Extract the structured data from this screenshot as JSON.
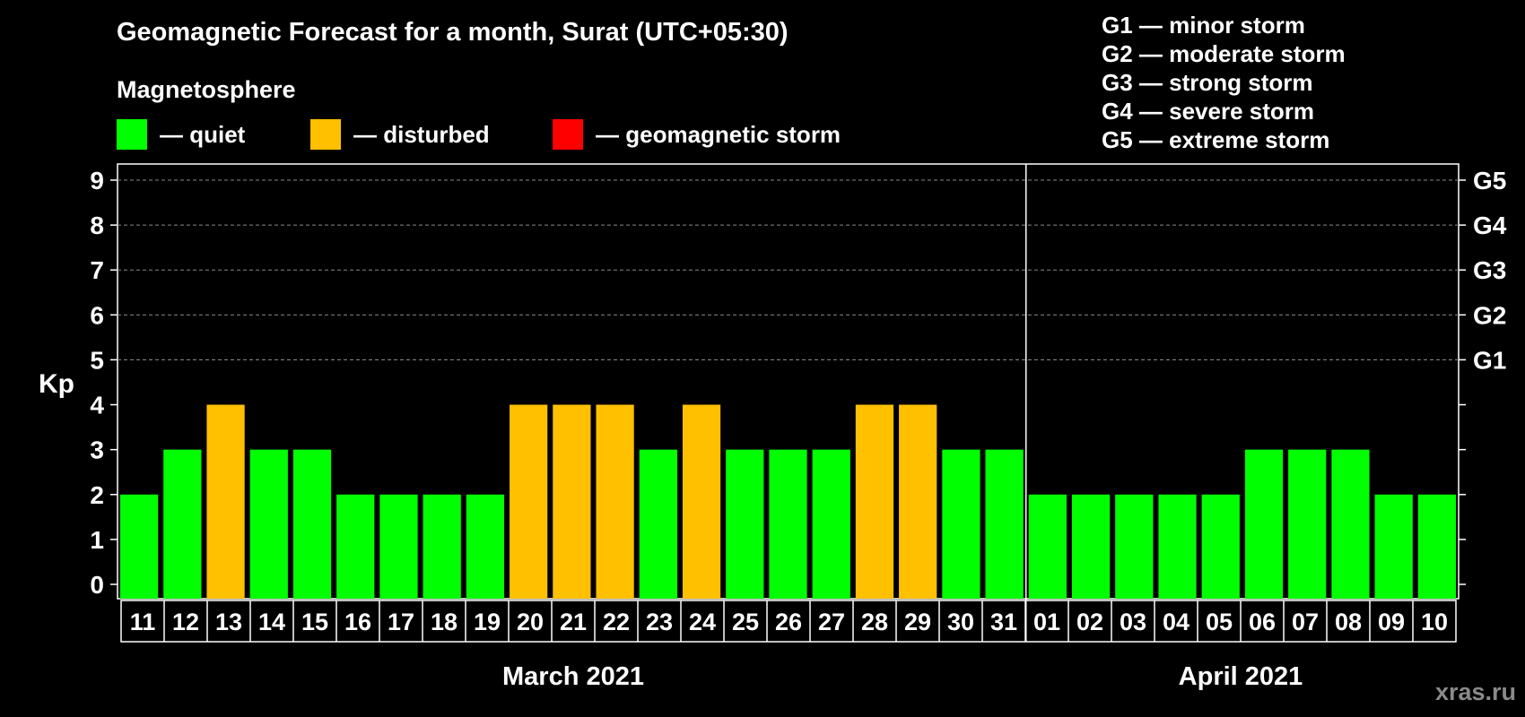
{
  "header": {
    "title": "Geomagnetic Forecast for a month, Surat (UTC+05:30)",
    "subtitle": "Magnetosphere"
  },
  "legend": [
    {
      "label": "— quiet",
      "color": "#00ff00"
    },
    {
      "label": "— disturbed",
      "color": "#ffc000"
    },
    {
      "label": "— geomagnetic storm",
      "color": "#ff0000"
    }
  ],
  "storm_levels": [
    "G1 — minor storm",
    "G2 — moderate storm",
    "G3 — strong storm",
    "G4 — severe storm",
    "G5 — extreme storm"
  ],
  "credit": "xras.ru",
  "chart_data": {
    "type": "bar",
    "ylabel": "Kp",
    "ylim": [
      0,
      9
    ],
    "yticks": [
      0,
      1,
      2,
      3,
      4,
      5,
      6,
      7,
      8,
      9
    ],
    "right_ticks": [
      {
        "value": 5,
        "label": "G1"
      },
      {
        "value": 6,
        "label": "G2"
      },
      {
        "value": 7,
        "label": "G3"
      },
      {
        "value": 8,
        "label": "G4"
      },
      {
        "value": 9,
        "label": "G5"
      }
    ],
    "gridlines": [
      5,
      6,
      7,
      8,
      9
    ],
    "categories": [
      "11",
      "12",
      "13",
      "14",
      "15",
      "16",
      "17",
      "18",
      "19",
      "20",
      "21",
      "22",
      "23",
      "24",
      "25",
      "26",
      "27",
      "28",
      "29",
      "30",
      "31",
      "01",
      "02",
      "03",
      "04",
      "05",
      "06",
      "07",
      "08",
      "09",
      "10"
    ],
    "values": [
      2,
      3,
      4,
      3,
      3,
      2,
      2,
      2,
      2,
      4,
      4,
      4,
      3,
      4,
      3,
      3,
      3,
      4,
      4,
      3,
      3,
      2,
      2,
      2,
      2,
      2,
      3,
      3,
      3,
      2,
      2
    ],
    "status": [
      "quiet",
      "quiet",
      "disturbed",
      "quiet",
      "quiet",
      "quiet",
      "quiet",
      "quiet",
      "quiet",
      "disturbed",
      "disturbed",
      "disturbed",
      "quiet",
      "disturbed",
      "quiet",
      "quiet",
      "quiet",
      "disturbed",
      "disturbed",
      "quiet",
      "quiet",
      "quiet",
      "quiet",
      "quiet",
      "quiet",
      "quiet",
      "quiet",
      "quiet",
      "quiet",
      "quiet",
      "quiet"
    ],
    "status_colors": {
      "quiet": "#00ff00",
      "disturbed": "#ffc000",
      "storm": "#ff0000"
    },
    "months": [
      {
        "label": "March 2021",
        "count": 21
      },
      {
        "label": "April 2021",
        "count": 10
      }
    ]
  }
}
